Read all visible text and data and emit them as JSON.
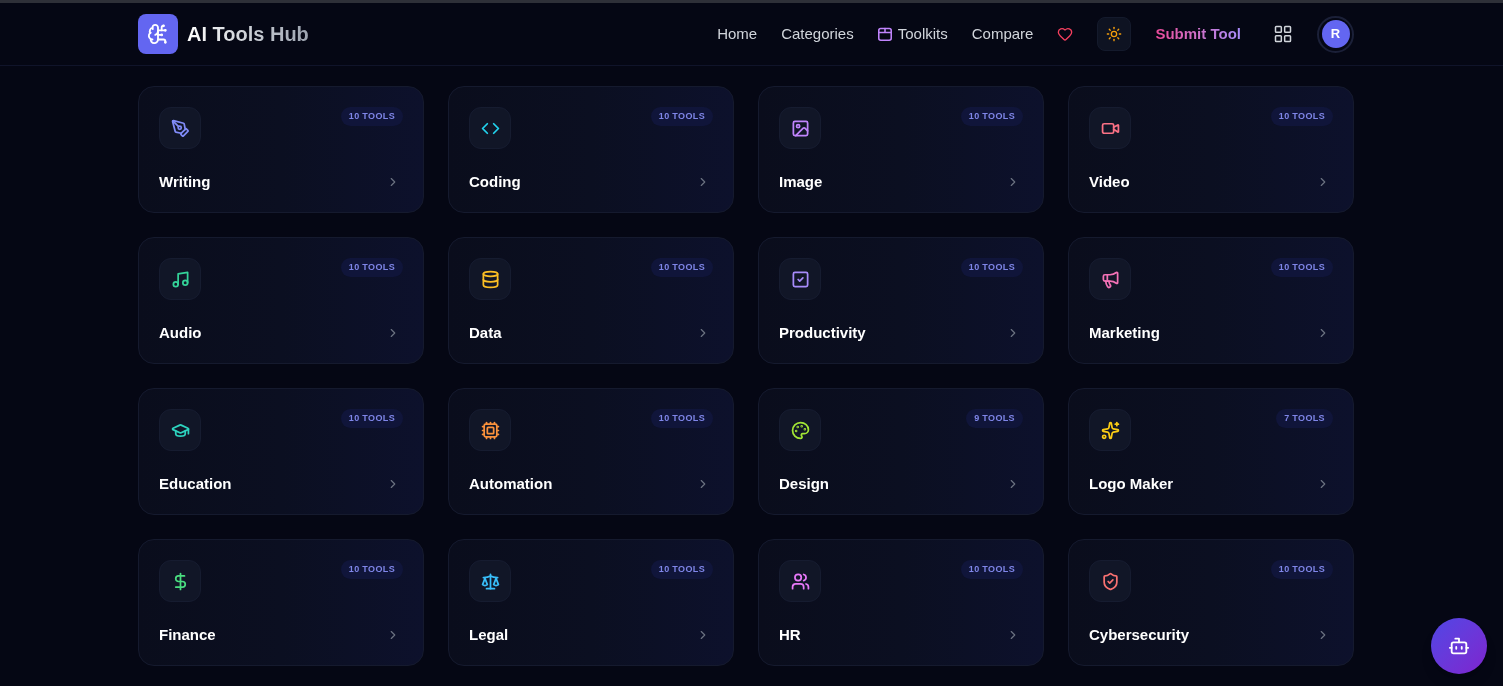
{
  "header": {
    "logo_text": "AI Tools Hub",
    "nav": [
      {
        "label": "Home",
        "kind": "text"
      },
      {
        "label": "Categories",
        "kind": "text"
      },
      {
        "label": "Toolkits",
        "kind": "icon_text"
      },
      {
        "label": "Compare",
        "kind": "text"
      }
    ],
    "submit_button": "Submit Tool",
    "avatar_initial": "R"
  },
  "categories": [
    {
      "name": "Writing",
      "count": "10 TOOLS",
      "color": "#818cf8"
    },
    {
      "name": "Coding",
      "count": "10 TOOLS",
      "color": "#22d3ee"
    },
    {
      "name": "Image",
      "count": "10 TOOLS",
      "color": "#c084fc"
    },
    {
      "name": "Video",
      "count": "10 TOOLS",
      "color": "#fb7185"
    },
    {
      "name": "Audio",
      "count": "10 TOOLS",
      "color": "#34d399"
    },
    {
      "name": "Data",
      "count": "10 TOOLS",
      "color": "#fbbf24"
    },
    {
      "name": "Productivity",
      "count": "10 TOOLS",
      "color": "#a78bfa"
    },
    {
      "name": "Marketing",
      "count": "10 TOOLS",
      "color": "#f472b6"
    },
    {
      "name": "Education",
      "count": "10 TOOLS",
      "color": "#2dd4bf"
    },
    {
      "name": "Automation",
      "count": "10 TOOLS",
      "color": "#fb923c"
    },
    {
      "name": "Design",
      "count": "9 TOOLS",
      "color": "#a3e635"
    },
    {
      "name": "Logo Maker",
      "count": "7 TOOLS",
      "color": "#facc15"
    },
    {
      "name": "Finance",
      "count": "10 TOOLS",
      "color": "#4ade80"
    },
    {
      "name": "Legal",
      "count": "10 TOOLS",
      "color": "#38bdf8"
    },
    {
      "name": "HR",
      "count": "10 TOOLS",
      "color": "#e879f9"
    },
    {
      "name": "Cybersecurity",
      "count": "10 TOOLS",
      "color": "#f87171"
    }
  ]
}
